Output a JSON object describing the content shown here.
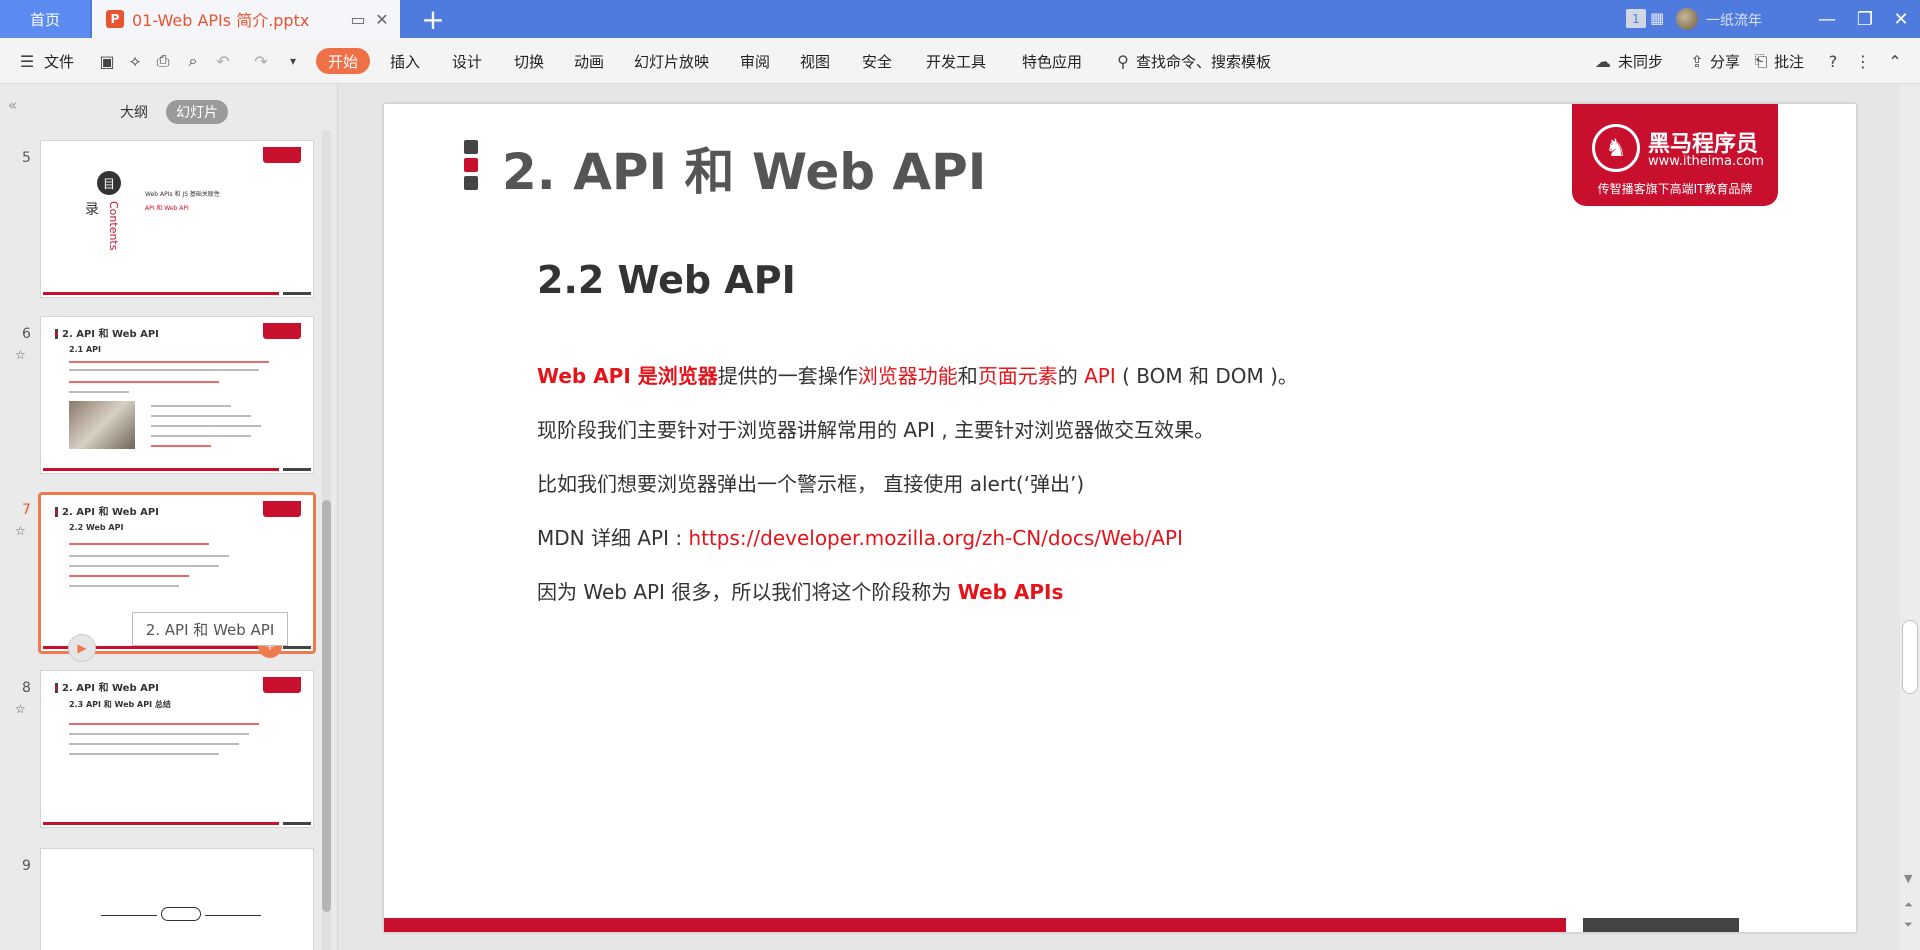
{
  "titlebar": {
    "home_tab": "首页",
    "doc_tab": "01-Web APIs 简介.pptx",
    "page_badge": "1",
    "user": "一纸流年"
  },
  "toolbar": {
    "file": "文件",
    "tabs": [
      "开始",
      "插入",
      "设计",
      "切换",
      "动画",
      "幻灯片放映",
      "审阅",
      "视图",
      "安全",
      "开发工具",
      "特色应用"
    ],
    "search": "查找命令、搜索模板",
    "sync": "未同步",
    "share": "分享",
    "comment": "批注"
  },
  "panel": {
    "tab_outline": "大纲",
    "tab_slides": "幻灯片",
    "tooltip": "2. API 和 Web API"
  },
  "thumbs": [
    {
      "num": "5",
      "dir_char1": "目",
      "dir_char2": "录",
      "contents": "Contents",
      "item1": "Web APIs 和 JS 基础关联性",
      "item2": "API 和 Web API"
    },
    {
      "num": "6",
      "title": "2. API 和 Web API",
      "sub": "2.1 API"
    },
    {
      "num": "7",
      "title": "2. API 和 Web API",
      "sub": "2.2 Web API"
    },
    {
      "num": "8",
      "title": "2. API 和 Web API",
      "sub": "2.3 API 和 Web API 总结"
    },
    {
      "num": "9"
    }
  ],
  "slide": {
    "title": "2. API 和 Web API",
    "logo_cn": "黑马程序员",
    "logo_url": "www.itheima.com",
    "logo_tag": "传智播客旗下高端IT教育品牌",
    "heading": "2.2 Web API",
    "p1": {
      "a": "Web API 是浏览器",
      "b": "提供的一套操作",
      "c": "浏览器功能",
      "d": "和",
      "e": "页面元素",
      "f": "的 ",
      "g": "API",
      "h": " ( BOM 和 DOM )。"
    },
    "p2": "现阶段我们主要针对于浏览器讲解常用的 API , 主要针对浏览器做交互效果。",
    "p3": "比如我们想要浏览器弹出一个警示框， 直接使用 alert(‘弹出’)",
    "p4_label": "MDN 详细 API : ",
    "p4_link": "https://developer.mozilla.org/zh-CN/docs/Web/API",
    "p5_text": "因为 Web API 很多，所以我们将这个阶段称为 ",
    "p5_em": "Web APIs"
  },
  "colors": {
    "accent": "#ef6f47",
    "brand_red": "#c8102e",
    "title_blue": "#4f7bde"
  }
}
